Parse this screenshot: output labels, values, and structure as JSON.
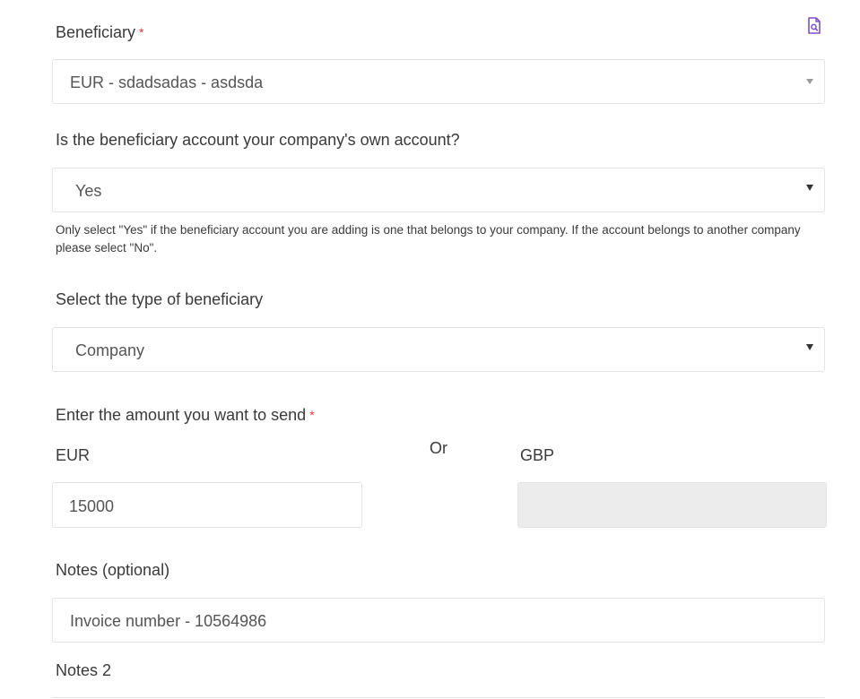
{
  "beneficiary": {
    "label": "Beneficiary",
    "required_mark": "*",
    "selected": "EUR - sdadsadas - asdsda",
    "icon": "document-search-icon"
  },
  "own_account": {
    "question": "Is the beneficiary account your company's own account?",
    "selected": "Yes",
    "helper": "Only select \"Yes\" if the beneficiary account you are adding is one that belongs to your company. If the account belongs to another company please select \"No\"."
  },
  "beneficiary_type": {
    "label": "Select the type of beneficiary",
    "selected": "Company"
  },
  "amount": {
    "label": "Enter the amount you want to send",
    "required_mark": "*",
    "eur_label": "EUR",
    "or_label": "Or",
    "gbp_label": "GBP",
    "eur_value": "15000",
    "gbp_value": ""
  },
  "notes": {
    "label": "Notes (optional)",
    "value": "Invoice number - 10564986"
  },
  "notes2": {
    "label": "Notes 2"
  },
  "colors": {
    "required": "#e53935",
    "icon": "#7b4fc9",
    "disabled_bg": "#ececec",
    "border": "#e3e3e3"
  }
}
